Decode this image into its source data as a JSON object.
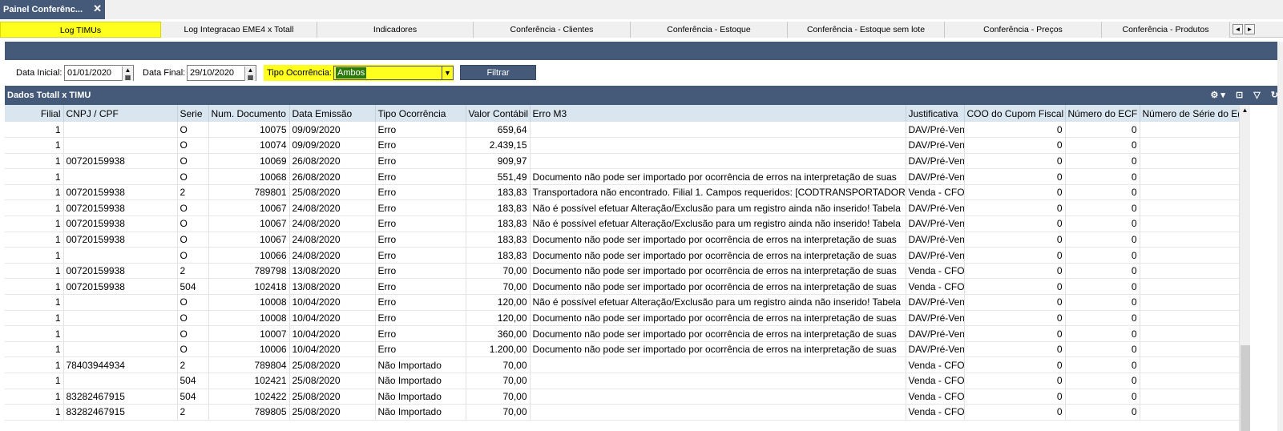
{
  "window_tab": {
    "title": "Painel Conferênc...",
    "close": "✕"
  },
  "tabs": [
    "Log TIMUs",
    "Log Integracao EME4 x Totall",
    "Indicadores",
    "Conferência - Clientes",
    "Conferência - Estoque",
    "Conferência - Estoque sem lote",
    "Conferência - Preços",
    "Conferência - Produtos"
  ],
  "tab_nav": {
    "prev": "◄",
    "next": "►"
  },
  "filter": {
    "data_inicial_label": "Data Inicial:",
    "data_inicial": "01/01/2020",
    "data_final_label": "Data Final:",
    "data_final": "29/10/2020",
    "tipo_label": "Tipo Ocorrência:",
    "tipo_value": "Ambos",
    "filtrar_label": "Filtrar"
  },
  "panel": {
    "title": "Dados Totall x TIMU",
    "tools": [
      "⚙ ▾",
      "⊡",
      "▽",
      "↻"
    ]
  },
  "grid": {
    "columns": [
      "Filial",
      "CNPJ / CPF",
      "Serie",
      "Num. Documento",
      "Data Emissão",
      "Tipo Ocorrência",
      "Valor Contábil",
      "Erro M3",
      "Justificativa",
      "COO do Cupom Fiscal",
      "Número do ECF",
      "Número de Série do E("
    ],
    "rows": [
      [
        "1",
        "",
        "O",
        "10075",
        "09/09/2020",
        "Erro",
        "659,64",
        "",
        "DAV/Pré-Ven",
        "0",
        "0",
        ""
      ],
      [
        "1",
        "",
        "O",
        "10074",
        "09/09/2020",
        "Erro",
        "2.439,15",
        "",
        "DAV/Pré-Ven",
        "0",
        "0",
        ""
      ],
      [
        "1",
        "00720159938",
        "O",
        "10069",
        "26/08/2020",
        "Erro",
        "909,97",
        "",
        "DAV/Pré-Ven",
        "0",
        "0",
        ""
      ],
      [
        "1",
        "",
        "O",
        "10068",
        "26/08/2020",
        "Erro",
        "551,49",
        "Documento não pode ser importado por ocorrência de erros na interpretação de suas",
        "DAV/Pré-Ven",
        "0",
        "0",
        ""
      ],
      [
        "1",
        "00720159938",
        "2",
        "789801",
        "25/08/2020",
        "Erro",
        "183,83",
        "Transportadora não encontrado. Filial 1. Campos requeridos: [CODTRANSPORTADOR",
        "Venda - CFO",
        "0",
        "0",
        ""
      ],
      [
        "1",
        "00720159938",
        "O",
        "10067",
        "24/08/2020",
        "Erro",
        "183,83",
        "Não é possível efetuar Alteração/Exclusão para um registro ainda não inserido! Tabela",
        "DAV/Pré-Ven",
        "0",
        "0",
        ""
      ],
      [
        "1",
        "00720159938",
        "O",
        "10067",
        "24/08/2020",
        "Erro",
        "183,83",
        "Não é possível efetuar Alteração/Exclusão para um registro ainda não inserido! Tabela",
        "DAV/Pré-Ven",
        "0",
        "0",
        ""
      ],
      [
        "1",
        "00720159938",
        "O",
        "10067",
        "24/08/2020",
        "Erro",
        "183,83",
        "Documento não pode ser importado por ocorrência de erros na interpretação de suas",
        "DAV/Pré-Ven",
        "0",
        "0",
        ""
      ],
      [
        "1",
        "",
        "O",
        "10066",
        "24/08/2020",
        "Erro",
        "183,83",
        "Documento não pode ser importado por ocorrência de erros na interpretação de suas",
        "DAV/Pré-Ven",
        "0",
        "0",
        ""
      ],
      [
        "1",
        "00720159938",
        "2",
        "789798",
        "13/08/2020",
        "Erro",
        "70,00",
        "Documento não pode ser importado por ocorrência de erros na interpretação de suas",
        "Venda - CFO",
        "0",
        "0",
        ""
      ],
      [
        "1",
        "00720159938",
        "504",
        "102418",
        "13/08/2020",
        "Erro",
        "70,00",
        "Documento não pode ser importado por ocorrência de erros na interpretação de suas",
        "Venda - CFO",
        "0",
        "0",
        ""
      ],
      [
        "1",
        "",
        "O",
        "10008",
        "10/04/2020",
        "Erro",
        "120,00",
        "Não é possível efetuar Alteração/Exclusão para um registro ainda não inserido! Tabela",
        "DAV/Pré-Ven",
        "0",
        "0",
        ""
      ],
      [
        "1",
        "",
        "O",
        "10008",
        "10/04/2020",
        "Erro",
        "120,00",
        "Documento não pode ser importado por ocorrência de erros na interpretação de suas",
        "DAV/Pré-Ven",
        "0",
        "0",
        ""
      ],
      [
        "1",
        "",
        "O",
        "10007",
        "10/04/2020",
        "Erro",
        "360,00",
        "Documento não pode ser importado por ocorrência de erros na interpretação de suas",
        "DAV/Pré-Ven",
        "0",
        "0",
        ""
      ],
      [
        "1",
        "",
        "O",
        "10006",
        "10/04/2020",
        "Erro",
        "1.200,00",
        "Documento não pode ser importado por ocorrência de erros na interpretação de suas",
        "DAV/Pré-Ven",
        "0",
        "0",
        ""
      ],
      [
        "1",
        "78403944934",
        "2",
        "789804",
        "25/08/2020",
        "Não Importado",
        "70,00",
        "",
        "Venda - CFO",
        "0",
        "0",
        ""
      ],
      [
        "1",
        "",
        "504",
        "102421",
        "25/08/2020",
        "Não Importado",
        "70,00",
        "",
        "Venda - CFO",
        "0",
        "0",
        ""
      ],
      [
        "1",
        "83282467915",
        "504",
        "102422",
        "25/08/2020",
        "Não Importado",
        "70,00",
        "",
        "Venda - CFO",
        "0",
        "0",
        ""
      ],
      [
        "1",
        "83282467915",
        "2",
        "789805",
        "25/08/2020",
        "Não Importado",
        "70,00",
        "",
        "Venda - CFO",
        "0",
        "0",
        ""
      ]
    ]
  }
}
